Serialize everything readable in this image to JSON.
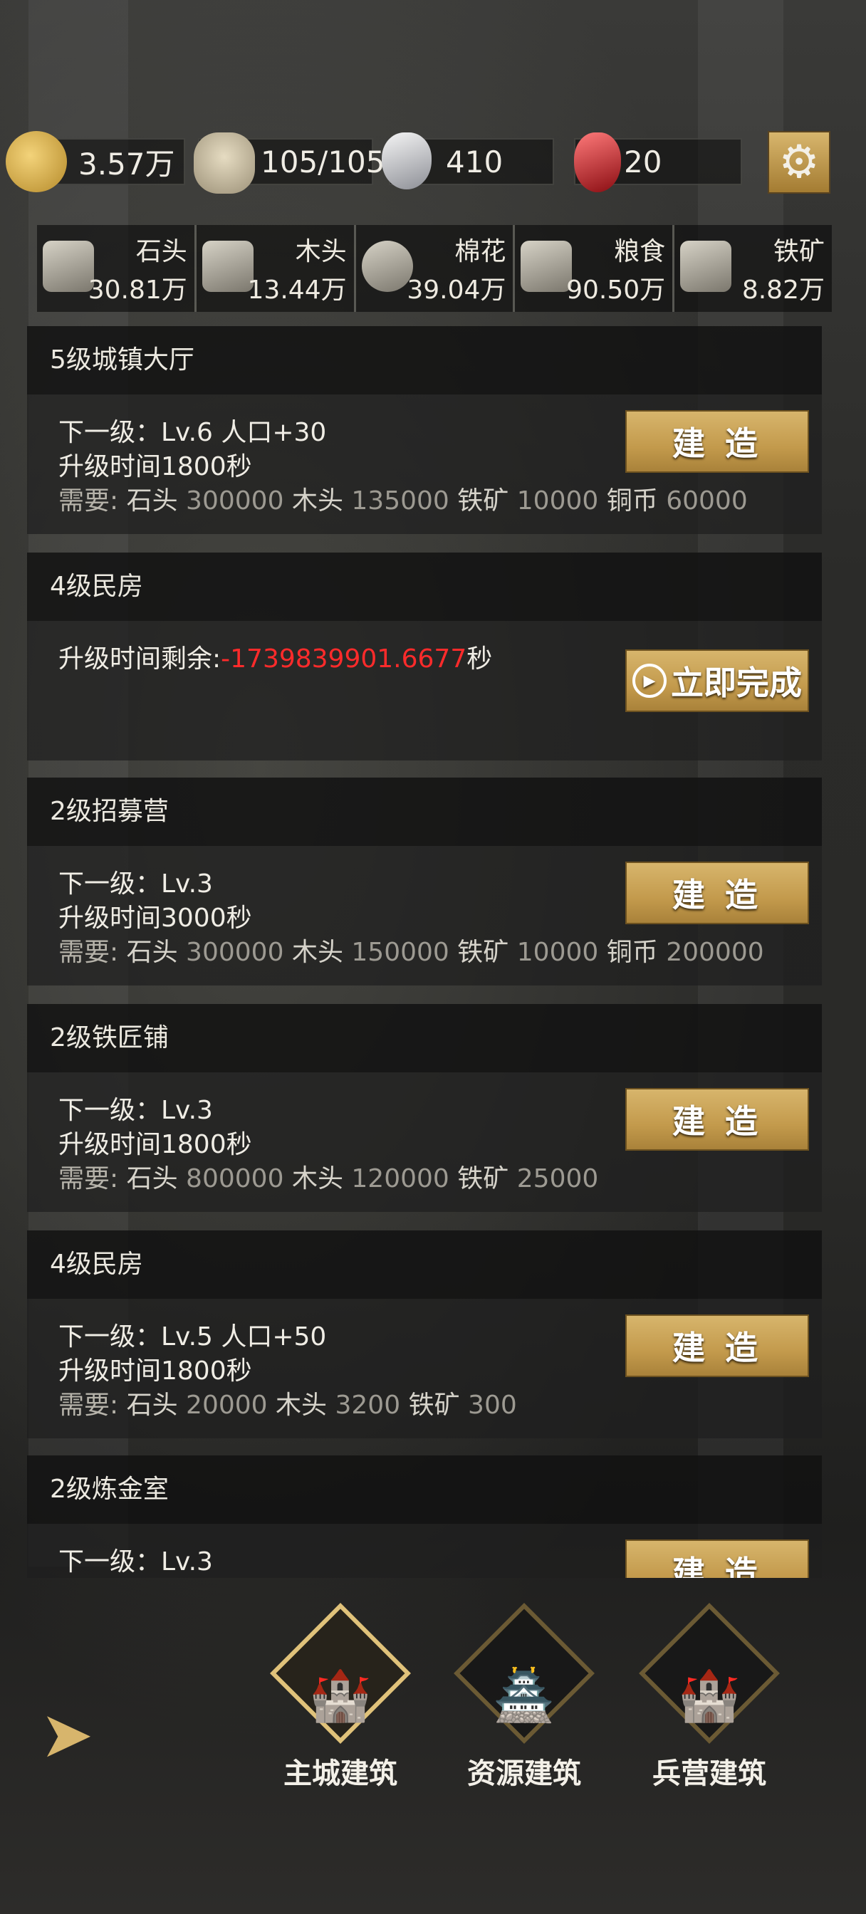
{
  "topbar": {
    "gold": "3.57万",
    "population": "105/105",
    "silver": "410",
    "gem": "20"
  },
  "materials": [
    {
      "name": "石头",
      "value": "30.81万"
    },
    {
      "name": "木头",
      "value": "13.44万"
    },
    {
      "name": "棉花",
      "value": "39.04万"
    },
    {
      "name": "粮食",
      "value": "90.50万"
    },
    {
      "name": "铁矿",
      "value": "8.82万"
    }
  ],
  "cards": [
    {
      "title": "5级城镇大厅",
      "next": "下一级：Lv.6   人口+30",
      "time": "升级时间1800秒",
      "need_label": "需要: ",
      "need": [
        [
          "石头",
          "300000"
        ],
        [
          "木头",
          "135000"
        ],
        [
          "铁矿",
          "10000"
        ],
        [
          "铜币",
          "60000"
        ]
      ],
      "button": "建 造"
    },
    {
      "title": "4级民房",
      "remain_label": "升级时间剩余:",
      "remain_value": "-1739839901.6677",
      "remain_unit": "秒",
      "button": "立即完成"
    },
    {
      "title": "2级招募营",
      "next": "下一级：Lv.3",
      "time": "升级时间3000秒",
      "need_label": "需要: ",
      "need": [
        [
          "石头",
          "300000"
        ],
        [
          "木头",
          "150000"
        ],
        [
          "铁矿",
          "10000"
        ],
        [
          "铜币",
          "200000"
        ]
      ],
      "button": "建 造"
    },
    {
      "title": "2级铁匠铺",
      "next": "下一级：Lv.3",
      "time": "升级时间1800秒",
      "need_label": "需要: ",
      "need": [
        [
          "石头",
          "800000"
        ],
        [
          "木头",
          "120000"
        ],
        [
          "铁矿",
          "25000"
        ]
      ],
      "button": "建 造"
    },
    {
      "title": "4级民房",
      "next": "下一级：Lv.5   人口+50",
      "time": "升级时间1800秒",
      "need_label": "需要: ",
      "need": [
        [
          "石头",
          "20000"
        ],
        [
          "木头",
          "3200"
        ],
        [
          "铁矿",
          "300"
        ]
      ],
      "button": "建 造"
    },
    {
      "title": "2级炼金室",
      "next": "下一级：Lv.3",
      "button": "建 造"
    }
  ],
  "nav": [
    {
      "label": "主城建筑"
    },
    {
      "label": "资源建筑"
    },
    {
      "label": "兵营建筑"
    }
  ],
  "icons": {
    "gear": "gear-icon",
    "back": "back-arrow-icon"
  },
  "colors": {
    "accent_gold": "#d7b56c",
    "countdown_red": "#ff2b2b"
  }
}
